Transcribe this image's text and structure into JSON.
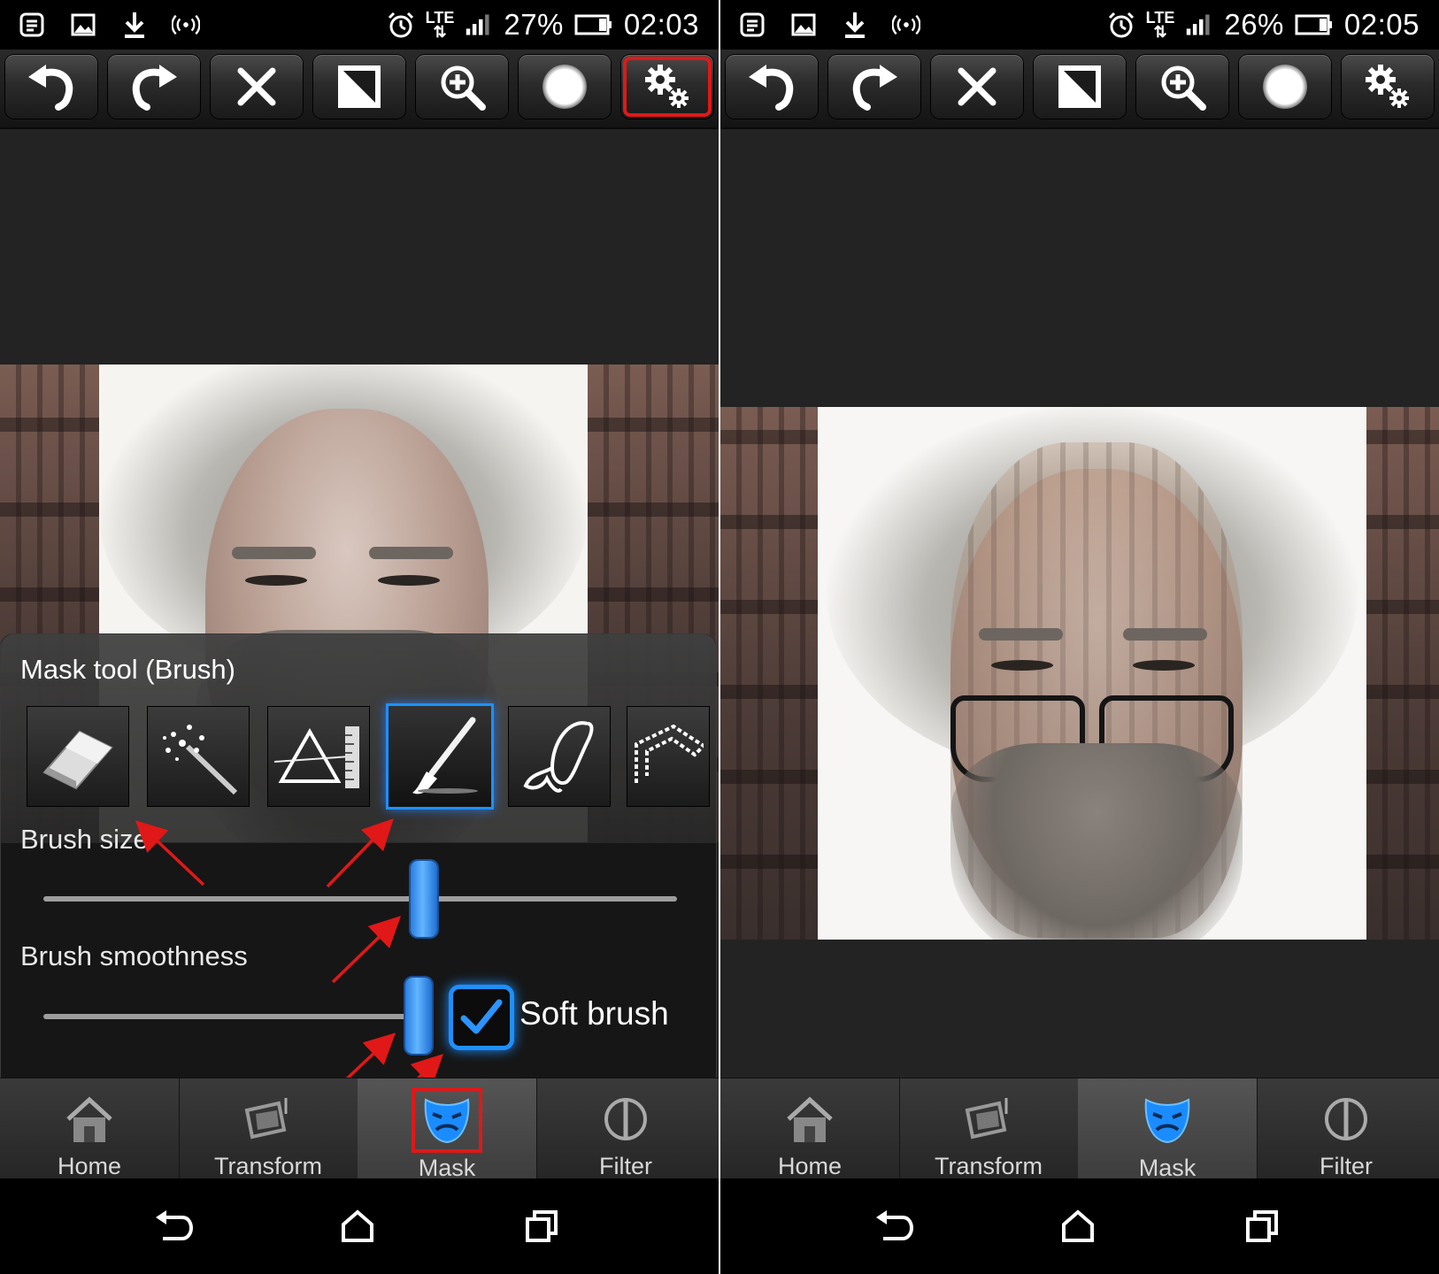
{
  "left": {
    "status": {
      "battery": "27%",
      "time": "02:03",
      "network": "LTE"
    },
    "mask_panel": {
      "title": "Mask tool (Brush)",
      "brush_size_label": "Brush size",
      "brush_size_level": 0.6,
      "brush_smoothness_label": "Brush smoothness",
      "brush_smoothness_level": 0.6,
      "soft_brush_label": "Soft brush",
      "soft_brush_checked": true,
      "tools": [
        "eraser-icon",
        "magic-wand-icon",
        "prism-ruler-icon",
        "brush-icon",
        "lasso-icon",
        "polygon-icon"
      ],
      "selected_tool": "brush-icon"
    }
  },
  "right": {
    "status": {
      "battery": "26%",
      "time": "02:05",
      "network": "LTE"
    }
  },
  "toolbar": [
    "undo-icon",
    "redo-icon",
    "close-icon",
    "contrast-icon",
    "zoom-in-icon",
    "soft-circle-icon",
    "settings-gears-icon"
  ],
  "tabs": [
    {
      "label": "Home",
      "icon": "home-icon"
    },
    {
      "label": "Transform",
      "icon": "transform-icon"
    },
    {
      "label": "Mask",
      "icon": "mask-icon"
    },
    {
      "label": "Filter",
      "icon": "filter-icon"
    }
  ],
  "active_tab": "Mask",
  "colors": {
    "accent": "#1e8fff",
    "highlight": "#e01818",
    "background": "#232323"
  }
}
